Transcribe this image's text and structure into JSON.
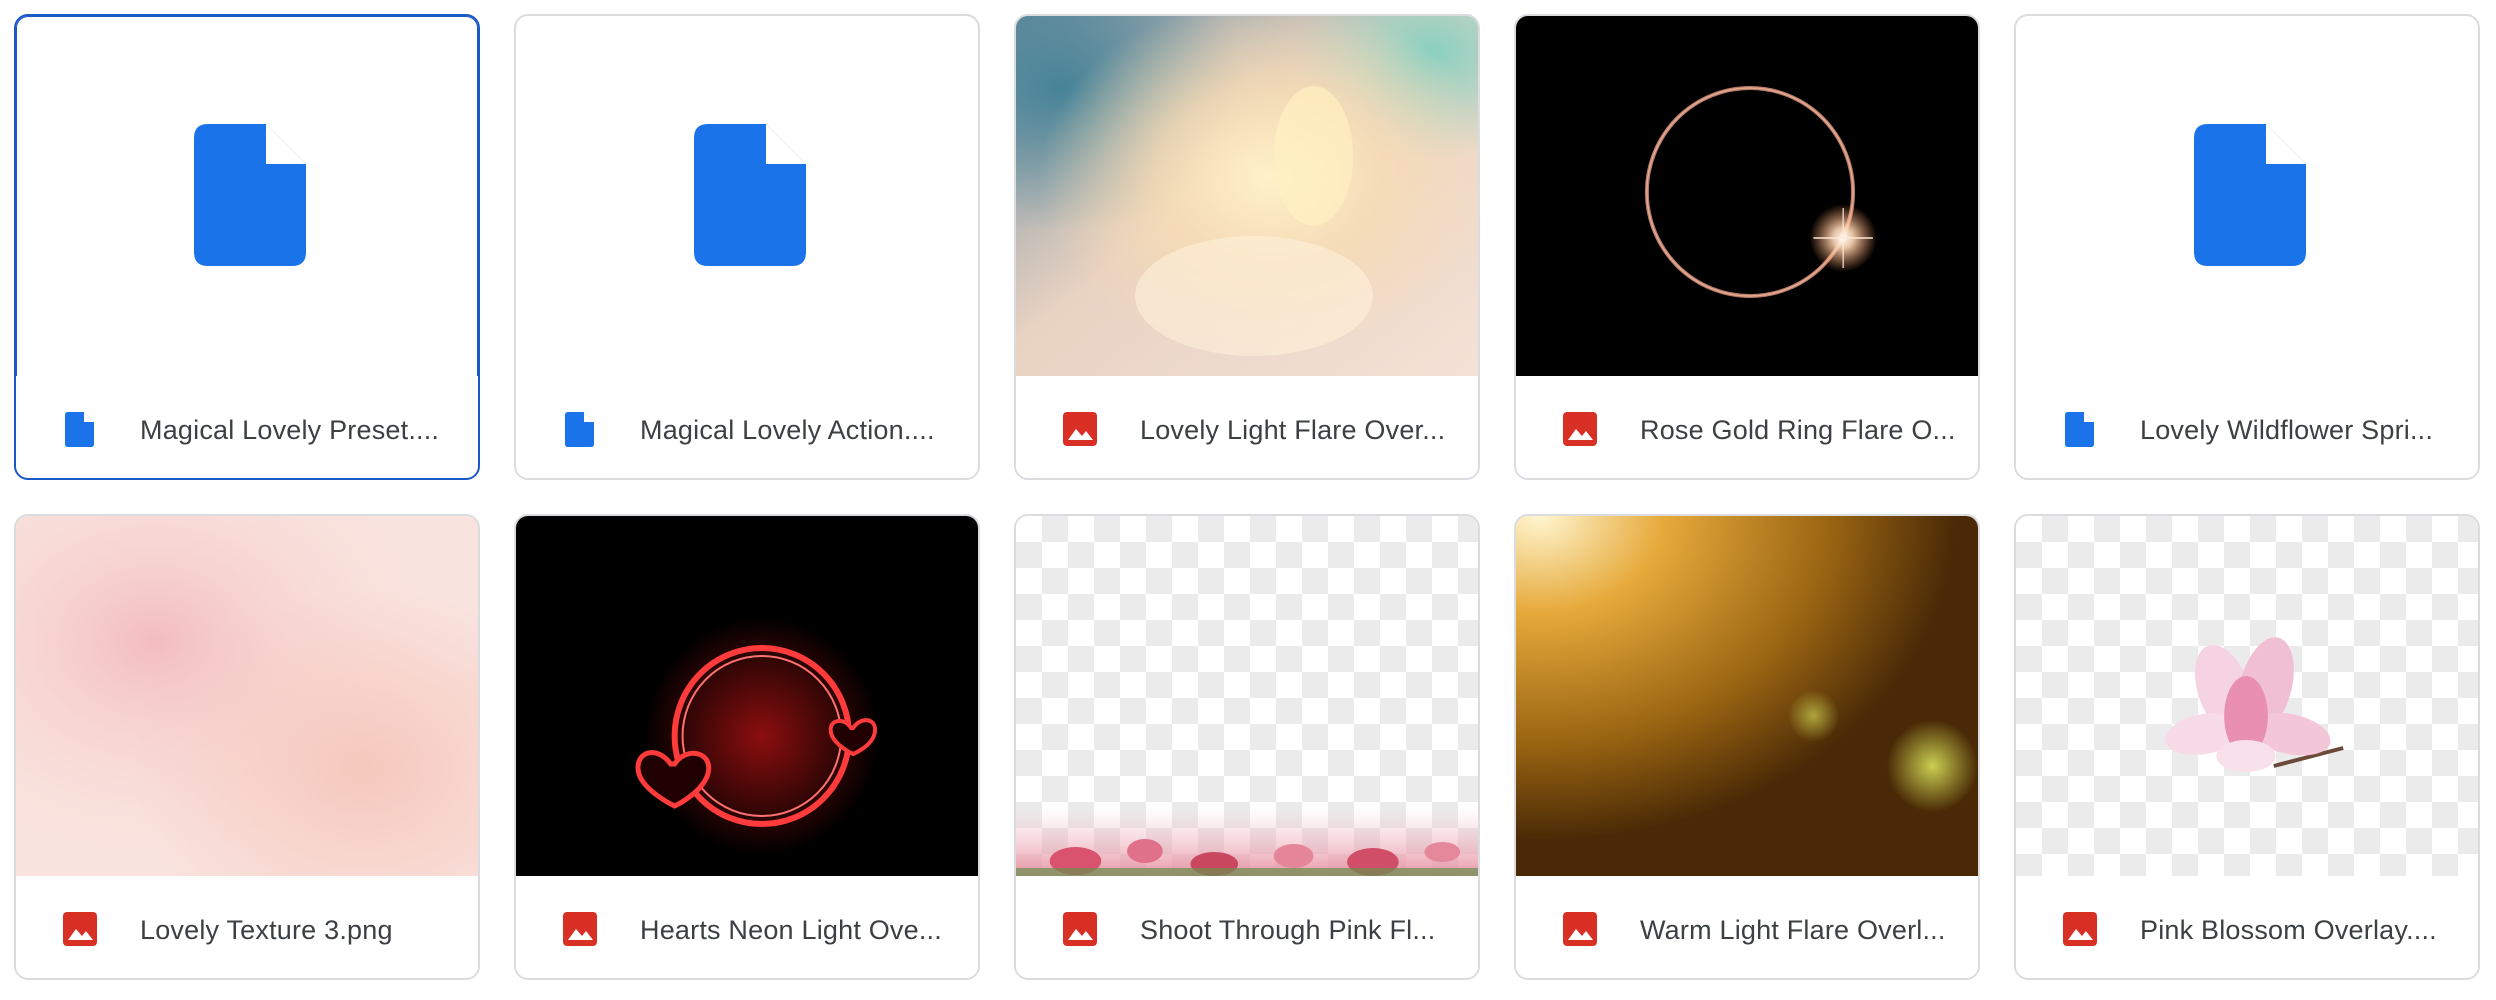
{
  "colors": {
    "doc_blue": "#1a73e8",
    "image_red": "#d93025",
    "selected_border": "#1a57c8",
    "card_border": "#dadce0",
    "text": "#3c4043"
  },
  "files": [
    {
      "name": "Magical Lovely Preset....",
      "type": "document",
      "icon": "document-icon",
      "selected": true
    },
    {
      "name": "Magical Lovely Action....",
      "type": "document",
      "icon": "document-icon",
      "selected": false
    },
    {
      "name": "Lovely Light Flare Over...",
      "type": "image",
      "icon": "image-icon",
      "selected": false
    },
    {
      "name": "Rose Gold Ring Flare O...",
      "type": "image",
      "icon": "image-icon",
      "selected": false
    },
    {
      "name": "Lovely Wildflower Spri...",
      "type": "document",
      "icon": "document-icon",
      "selected": false
    },
    {
      "name": "Lovely Texture 3.png",
      "type": "image",
      "icon": "image-icon",
      "selected": false
    },
    {
      "name": "Hearts Neon Light Ove...",
      "type": "image",
      "icon": "image-icon",
      "selected": false
    },
    {
      "name": "Shoot Through Pink Fl...",
      "type": "image",
      "icon": "image-icon",
      "selected": false
    },
    {
      "name": "Warm Light Flare Overl...",
      "type": "image",
      "icon": "image-icon",
      "selected": false
    },
    {
      "name": "Pink Blossom Overlay....",
      "type": "image",
      "icon": "image-icon",
      "selected": false
    }
  ]
}
